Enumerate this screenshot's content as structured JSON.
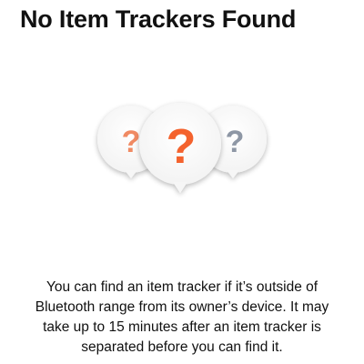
{
  "page": {
    "title": "No Item Trackers Found",
    "description": "You can find an item tracker if it’s outside of Bluetooth range from its owner’s device. It may take up to 15 minutes after an item tracker is separated before you can find it."
  },
  "illustration": {
    "icon": "question-bubbles-icon",
    "bubbles": [
      {
        "mark": "?",
        "color": "#f08a63"
      },
      {
        "mark": "?",
        "color": "#f4622d"
      },
      {
        "mark": "?",
        "color": "#8e97a5"
      }
    ]
  }
}
